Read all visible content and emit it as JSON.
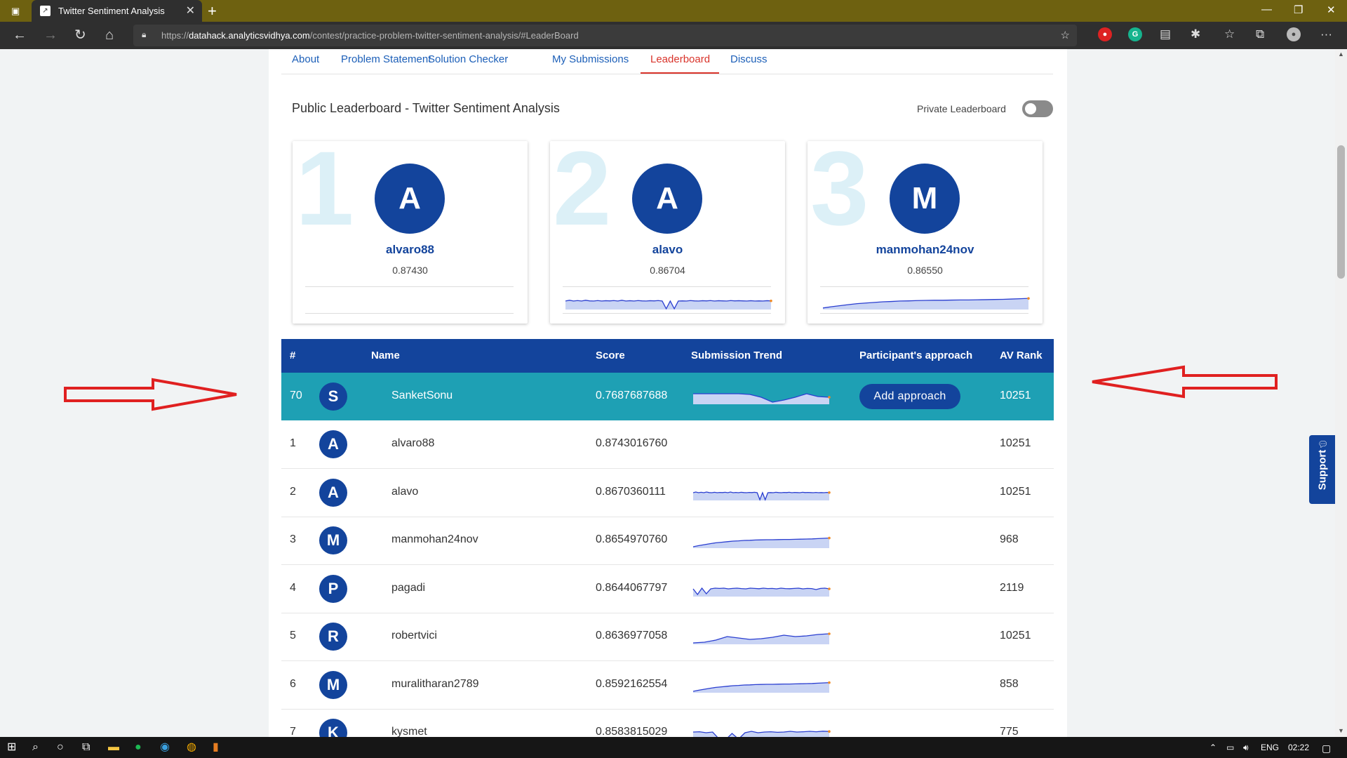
{
  "browser": {
    "tab_title": "Twitter Sentiment Analysis",
    "url_prefix": "https://",
    "url_host": "datahack.analyticsvidhya.com",
    "url_path": "/contest/practice-problem-twitter-sentiment-analysis/#LeaderBoard"
  },
  "subnav": {
    "about": "About",
    "problem": "Problem Statement",
    "checker": "Solution Checker",
    "submissions": "My Submissions",
    "leaderboard": "Leaderboard",
    "discuss": "Discuss"
  },
  "leaderboard": {
    "title": "Public Leaderboard - Twitter Sentiment Analysis",
    "private_label": "Private Leaderboard",
    "private_enabled": false
  },
  "podium": [
    {
      "rank": "1",
      "initial": "A",
      "name": "alvaro88",
      "score": "0.87430",
      "trend": "none"
    },
    {
      "rank": "2",
      "initial": "A",
      "name": "alavo",
      "score": "0.86704",
      "trend": "dip"
    },
    {
      "rank": "3",
      "initial": "M",
      "name": "manmohan24nov",
      "score": "0.86550",
      "trend": "rise"
    }
  ],
  "table": {
    "headers": {
      "rank": "#",
      "name": "Name",
      "score": "Score",
      "trend": "Submission Trend",
      "approach": "Participant's approach",
      "av_rank": "AV Rank"
    },
    "rows": [
      {
        "rank": "70",
        "initial": "S",
        "name": "SanketSonu",
        "score": "0.7687687688",
        "approach": "Add approach",
        "av_rank": "10251",
        "trend": "valley",
        "highlight": true
      },
      {
        "rank": "1",
        "initial": "A",
        "name": "alvaro88",
        "score": "0.8743016760",
        "approach": "",
        "av_rank": "10251",
        "trend": "none"
      },
      {
        "rank": "2",
        "initial": "A",
        "name": "alavo",
        "score": "0.8670360111",
        "approach": "",
        "av_rank": "10251",
        "trend": "dip"
      },
      {
        "rank": "3",
        "initial": "M",
        "name": "manmohan24nov",
        "score": "0.8654970760",
        "approach": "",
        "av_rank": "968",
        "trend": "rise"
      },
      {
        "rank": "4",
        "initial": "P",
        "name": "pagadi",
        "score": "0.8644067797",
        "approach": "",
        "av_rank": "2119",
        "trend": "noisy"
      },
      {
        "rank": "5",
        "initial": "R",
        "name": "robertvici",
        "score": "0.8636977058",
        "approach": "",
        "av_rank": "10251",
        "trend": "wave"
      },
      {
        "rank": "6",
        "initial": "M",
        "name": "muralitharan2789",
        "score": "0.8592162554",
        "approach": "",
        "av_rank": "858",
        "trend": "rise"
      },
      {
        "rank": "7",
        "initial": "K",
        "name": "kysmet",
        "score": "0.8583815029",
        "approach": "",
        "av_rank": "775",
        "trend": "double-dip"
      }
    ]
  },
  "support_label": "Support",
  "taskbar": {
    "lang": "ENG",
    "time": "02:22"
  },
  "colors": {
    "brand": "#13449c",
    "highlight_row": "#1ea0b4",
    "accent": "#d9342b",
    "annotation_arrow": "#e02020"
  }
}
